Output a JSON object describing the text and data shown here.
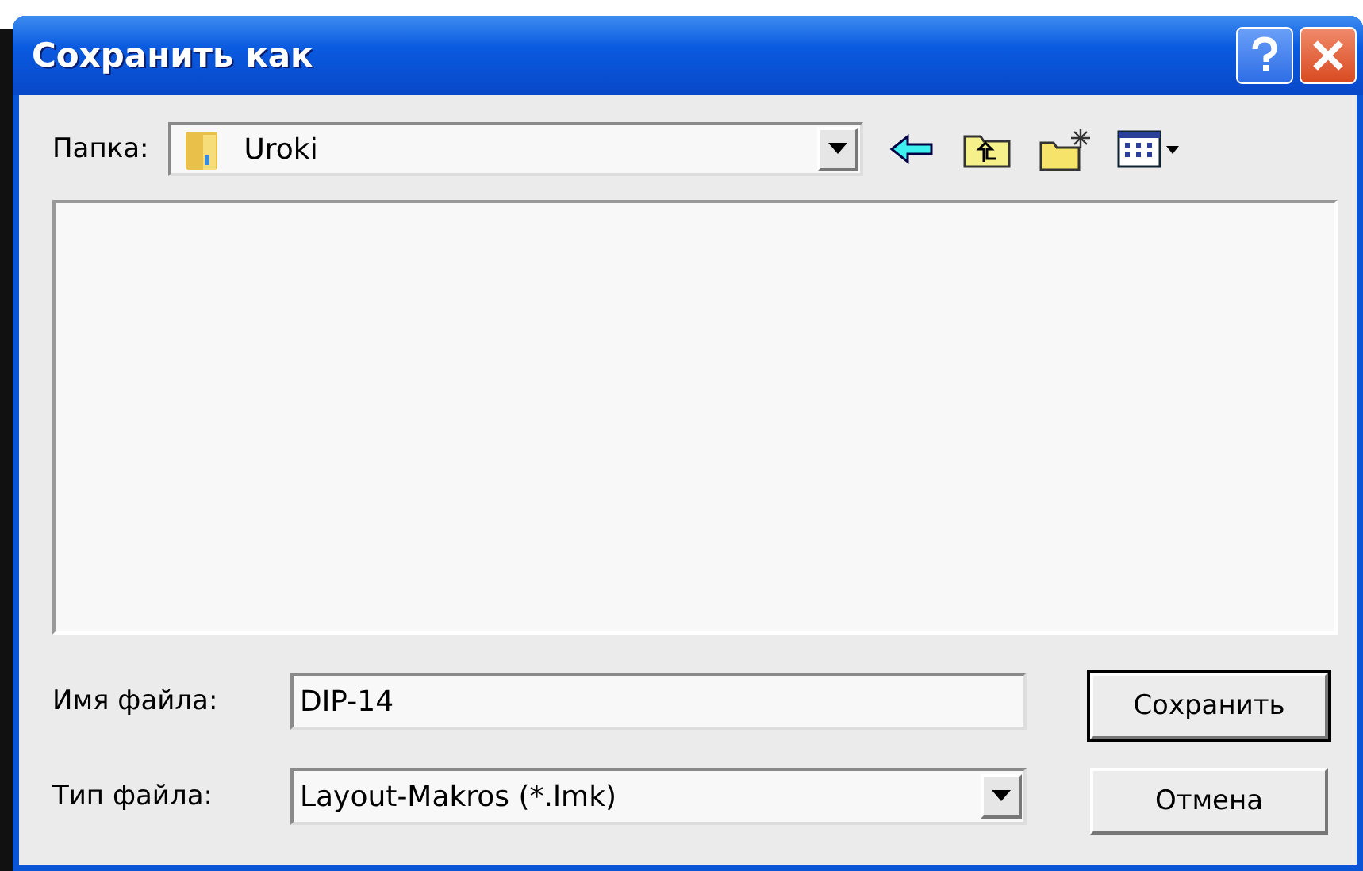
{
  "window": {
    "title": "Сохранить как"
  },
  "folder": {
    "label": "Папка:",
    "value": "Uroki"
  },
  "file_name": {
    "label": "Имя файла:",
    "value": "DIP-14"
  },
  "file_type": {
    "label": "Тип файла:",
    "value": "Layout-Makros (*.lmk)"
  },
  "buttons": [
    {
      "label": "Сохранить",
      "default": true
    },
    {
      "label": "Отмена",
      "default": false
    }
  ]
}
